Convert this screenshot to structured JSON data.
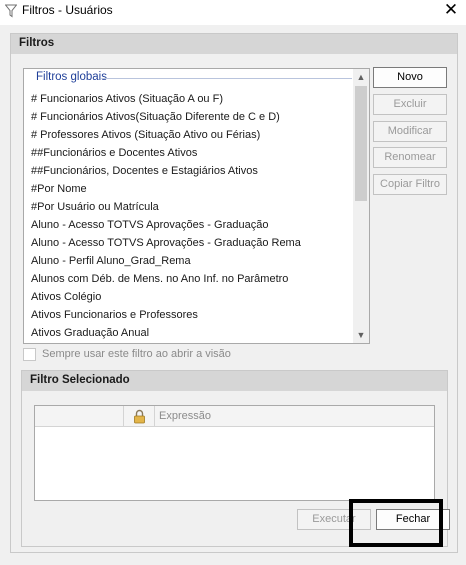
{
  "window": {
    "title": "Filtros - Usuários",
    "icon": "filter-funnel-icon",
    "close_glyph": "✕"
  },
  "filters_panel": {
    "header": "Filtros",
    "list": {
      "group_label": "Filtros globais",
      "items": [
        "# Funcionarios Ativos (Situação A ou F)",
        "# Funcionários Ativos(Situação Diferente de C e D)",
        "# Professores Ativos (Situação Ativo ou Férias)",
        "##Funcionários e Docentes Ativos",
        "##Funcionários, Docentes e Estagiários Ativos",
        "#Por Nome",
        "#Por Usuário ou Matrícula",
        "Aluno - Acesso TOTVS Aprovações - Graduação",
        "Aluno - Acesso TOTVS Aprovações - Graduação Rema",
        "Aluno - Perfil Aluno_Grad_Rema",
        "Alunos com Déb. de Mens. no Ano Inf. no Parâmetro",
        "Ativos Colégio",
        "Ativos Funcionarios e Professores",
        "Ativos Graduação Anual"
      ],
      "scroll_up_glyph": "▲",
      "scroll_down_glyph": "▼"
    },
    "buttons": {
      "novo": "Novo",
      "excluir": "Excluir",
      "modificar": "Modificar",
      "renomear": "Renomear",
      "copiar": "Copiar Filtro"
    },
    "always_use_label": "Sempre usar este filtro ao abrir a visão"
  },
  "selected_panel": {
    "header": "Filtro Selecionado",
    "grid": {
      "columns": [
        "",
        "lock-icon",
        "Expressão"
      ],
      "expression_header": "Expressão"
    },
    "buttons": {
      "executar": "Executar",
      "fechar": "Fechar"
    }
  },
  "colors": {
    "group_label": "#1f3f99",
    "header_bg": "#d6d6d6",
    "window_bg": "#f0f0f0",
    "disabled_text": "#9a9a9a",
    "highlight_border": "#000000"
  }
}
